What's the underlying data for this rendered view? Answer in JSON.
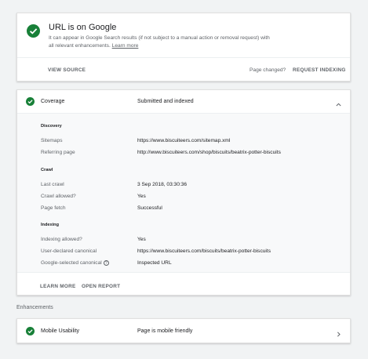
{
  "status_card": {
    "title": "URL is on Google",
    "description": "It can appear in Google Search results (if not subject to a manual action or removal request) with all relevant enhancements.",
    "learn_more": "Learn more",
    "view_source": "VIEW SOURCE",
    "page_changed": "Page changed?",
    "request_indexing": "REQUEST INDEXING",
    "icon": "check-circle-icon",
    "status_color": "#188038"
  },
  "coverage": {
    "label": "Coverage",
    "status": "Submitted and indexed",
    "sections": {
      "discovery": {
        "title": "Discovery",
        "rows": [
          {
            "label": "Sitemaps",
            "value": "https://www.biscuiteers.com/sitemap.xml"
          },
          {
            "label": "Referring page",
            "value": "http://www.biscuiteers.com/shop/biscuits/beatrix-potter-biscuits"
          }
        ]
      },
      "crawl": {
        "title": "Crawl",
        "rows": [
          {
            "label": "Last crawl",
            "value": "3 Sep 2018, 03:30:36"
          },
          {
            "label": "Crawl allowed?",
            "value": "Yes"
          },
          {
            "label": "Page fetch",
            "value": "Successful"
          }
        ]
      },
      "indexing": {
        "title": "Indexing",
        "rows": [
          {
            "label": "Indexing allowed?",
            "value": "Yes"
          },
          {
            "label": "User-declared canonical",
            "value": "https://www.biscuiteers.com/biscuits/beatrix-potter-biscuits"
          },
          {
            "label": "Google-selected canonical",
            "value": "Inspected URL"
          }
        ]
      }
    },
    "learn_more": "LEARN MORE",
    "open_report": "OPEN REPORT"
  },
  "enhancements": {
    "heading": "Enhancements",
    "items": [
      {
        "label": "Mobile Usability",
        "status": "Page is mobile friendly"
      }
    ]
  }
}
